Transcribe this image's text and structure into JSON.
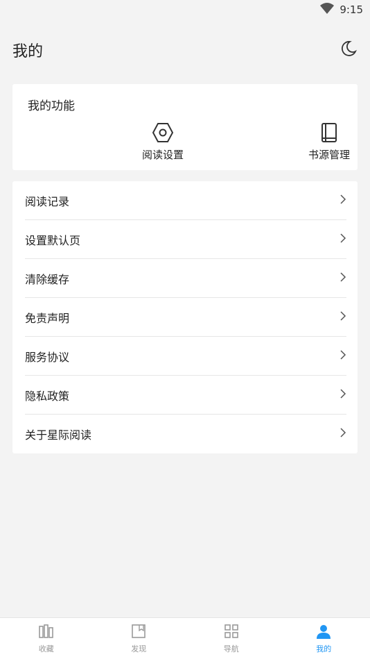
{
  "status_bar": {
    "time": "9:15",
    "wifi_icon": "wifi-icon"
  },
  "header": {
    "title": "我的",
    "theme_icon": "moon-icon"
  },
  "features": {
    "title": "我的功能",
    "items": [
      {
        "label": "阅读设置",
        "icon": "hexagon-settings-icon"
      },
      {
        "label": "书源管理",
        "icon": "book-icon"
      }
    ]
  },
  "menu": {
    "items": [
      {
        "label": "阅读记录"
      },
      {
        "label": "设置默认页"
      },
      {
        "label": "清除缓存"
      },
      {
        "label": "免责声明"
      },
      {
        "label": "服务协议"
      },
      {
        "label": "隐私政策"
      },
      {
        "label": "关于星际阅读"
      }
    ],
    "chevron_icon": "chevron-right-icon"
  },
  "bottom_nav": {
    "items": [
      {
        "label": "收藏",
        "icon": "bookshelf-icon",
        "active": false
      },
      {
        "label": "发现",
        "icon": "bookmark-page-icon",
        "active": false
      },
      {
        "label": "导航",
        "icon": "grid-icon",
        "active": false
      },
      {
        "label": "我的",
        "icon": "person-icon",
        "active": true
      }
    ],
    "active_color": "#2196f3",
    "inactive_color": "#999999"
  }
}
